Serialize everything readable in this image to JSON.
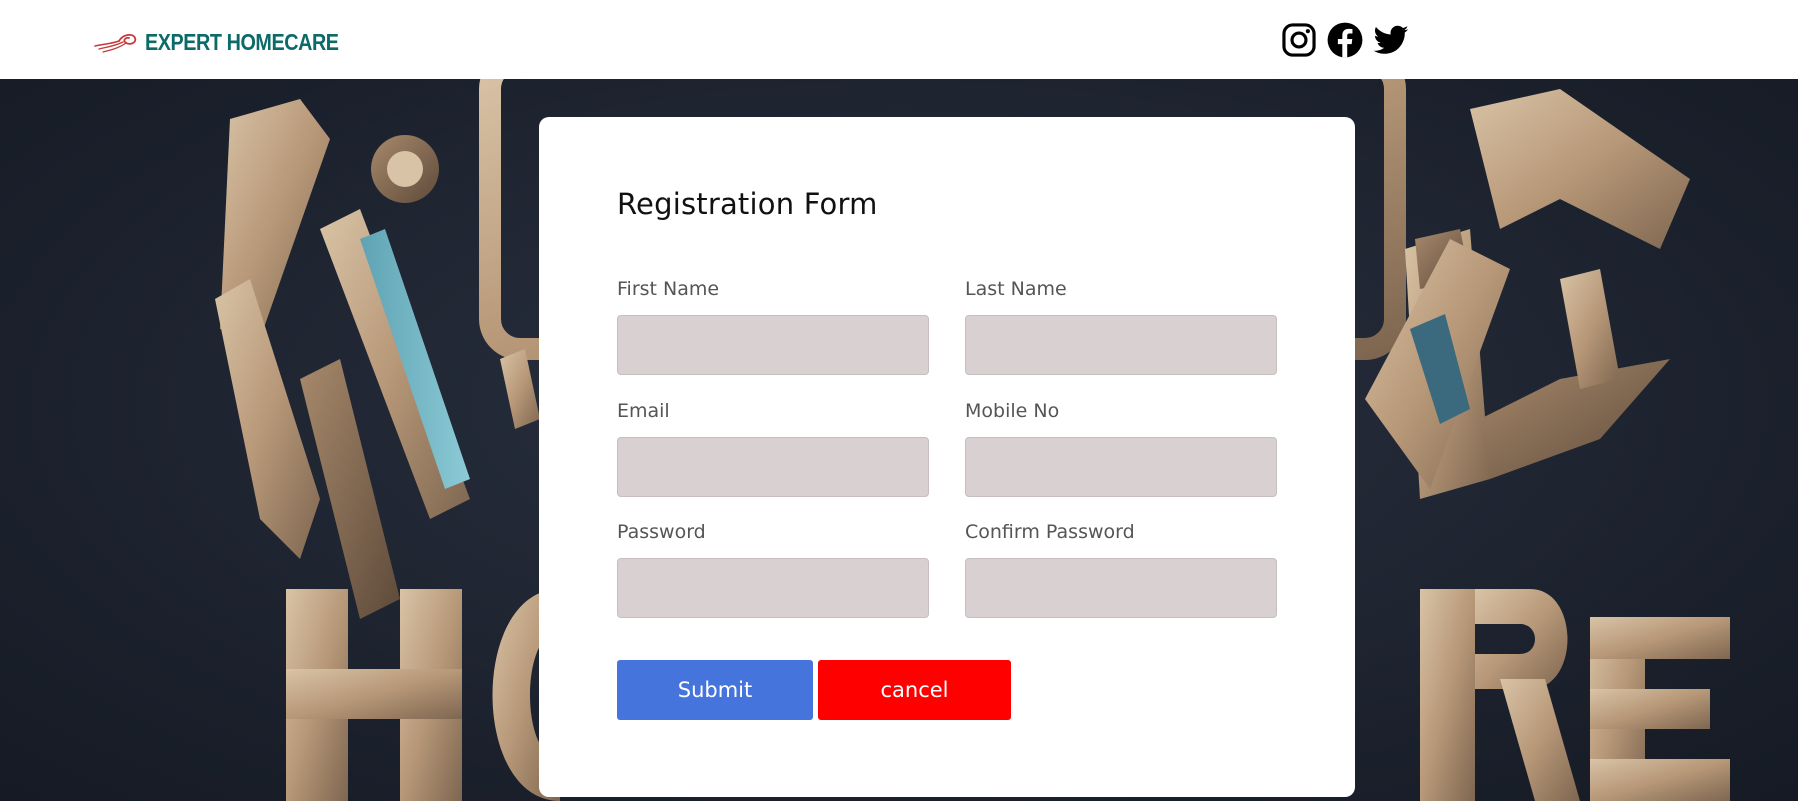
{
  "header": {
    "brand_name": "EXPERT HOMECARE",
    "brand_color": "#0c6a68",
    "social_icons": [
      "instagram-icon",
      "facebook-icon",
      "twitter-icon"
    ]
  },
  "form": {
    "title": "Registration Form",
    "fields": {
      "first_name": {
        "label": "First Name",
        "value": ""
      },
      "last_name": {
        "label": "Last Name",
        "value": ""
      },
      "email": {
        "label": "Email",
        "value": ""
      },
      "mobile": {
        "label": "Mobile No",
        "value": ""
      },
      "password": {
        "label": "Password",
        "value": ""
      },
      "confirm_password": {
        "label": "Confirm Password",
        "value": ""
      }
    },
    "submit_label": "Submit",
    "cancel_label": "cancel",
    "submit_color": "#4575dc",
    "cancel_color": "#ff0000",
    "input_bg_color": "#d9d1d1"
  }
}
